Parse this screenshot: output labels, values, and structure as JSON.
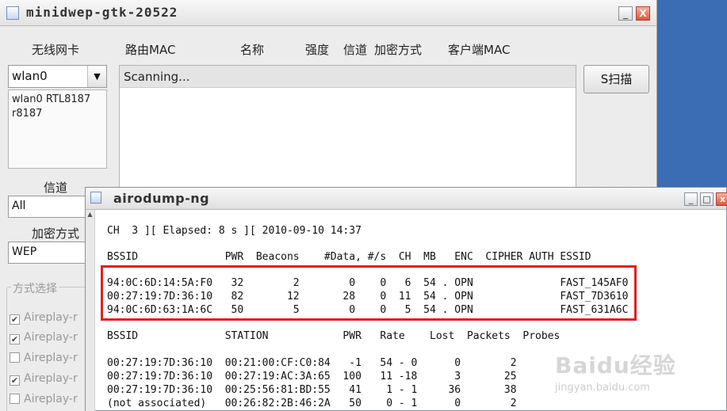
{
  "main_window": {
    "title": "minidwep-gtk-20522",
    "min_label": "_",
    "close_label": "X"
  },
  "headers": {
    "wireless_card": "无线网卡",
    "router_mac": "路由MAC",
    "name": "名称",
    "strength": "强度",
    "channel": "信道",
    "encryption": "加密方式",
    "client_mac": "客户端MAC"
  },
  "interface": {
    "selected": "wlan0",
    "details_line1": "wlan0 RTL8187",
    "details_line2": "r8187"
  },
  "scan": {
    "status": "Scanning...",
    "button_label": "S扫描"
  },
  "left_panel": {
    "channel_label": "信道",
    "channel_value": "All",
    "encryption_label": "加密方式",
    "encryption_value": "WEP",
    "mode_group_title": "方式选择",
    "modes": [
      {
        "label": "Aireplay-r",
        "checked": "✔"
      },
      {
        "label": "Aireplay-r",
        "checked": "✔"
      },
      {
        "label": "Aireplay-r",
        "checked": ""
      },
      {
        "label": "Aireplay-r",
        "checked": "✔"
      },
      {
        "label": "Aireplay-r",
        "checked": ""
      }
    ]
  },
  "airodump": {
    "title": "airodump-ng",
    "status_line": "CH  3 ][ Elapsed: 8 s ][ 2010-09-10 14:37",
    "ap_header": "BSSID              PWR  Beacons    #Data, #/s  CH  MB   ENC  CIPHER AUTH ESSID",
    "ap_rows": [
      "94:0C:6D:14:5A:F0   32        2        0    0   6  54 . OPN              FAST_145AF0",
      "00:27:19:7D:36:10   82       12       28    0  11  54 . OPN              FAST_7D3610",
      "94:0C:6D:63:1A:6C   50        5        0    0   5  54 . OPN              FAST_631A6C"
    ],
    "station_header": "BSSID              STATION            PWR   Rate    Lost  Packets  Probes",
    "station_rows": [
      "00:27:19:7D:36:10  00:21:00:CF:C0:84   -1   54 - 0      0        2",
      "00:27:19:7D:36:10  00:27:19:AC:3A:65  100   11 -18      3       25",
      "00:27:19:7D:36:10  00:25:56:81:BD:55   41    1 - 1     36       38",
      "(not associated)   00:26:82:2B:46:2A   50    0 - 1      0        2"
    ]
  },
  "watermark": {
    "logo": "Baidu经验",
    "url": "jingyan.baidu.com"
  }
}
